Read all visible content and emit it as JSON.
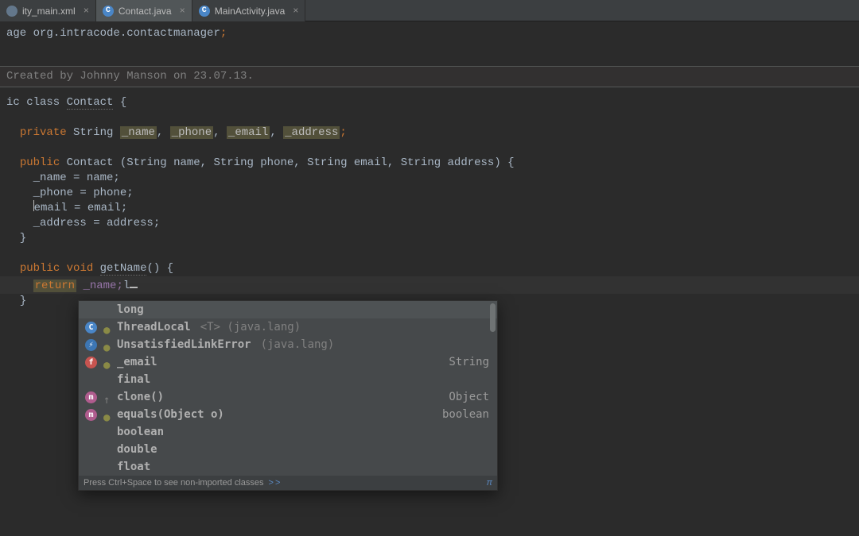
{
  "tabs": [
    {
      "label": "ity_main.xml",
      "icon_letter": "",
      "icon_class": "xml-icon",
      "active": false
    },
    {
      "label": "Contact.java",
      "icon_letter": "C",
      "icon_class": "java-icon",
      "active": true
    },
    {
      "label": "MainActivity.java",
      "icon_letter": "C",
      "icon_class": "java-icon",
      "active": false
    }
  ],
  "code": {
    "package_line_prefix": "age ",
    "package": "org.intracode.contactmanager",
    "comment_line": "Created by Johnny Manson on 23.07.13.",
    "class_decl_prefix": "ic class ",
    "class_name": "Contact",
    "class_decl_suffix": " {",
    "private_kw": "private",
    "string_type": "String",
    "fields": [
      "_name",
      "_phone",
      "_email",
      "_address"
    ],
    "public_kw": "public",
    "ctor": "Contact (String name, String phone, String email, String address) {",
    "assign": {
      "name": "_name = name;",
      "phone": "_phone = phone;",
      "email": "email = email;",
      "caret_line_prefix": "    ",
      "address": "_address = address;"
    },
    "void_kw": "void",
    "getname": "getName",
    "getname_suffix": "() {",
    "return_kw": "return",
    "return_val": "_name;",
    "typed": "l"
  },
  "popup": {
    "items": [
      {
        "icon": "",
        "icon_class": "",
        "label": "long",
        "aux": "",
        "type": "",
        "selected": true
      },
      {
        "icon": "C",
        "icon_class": "ic-class",
        "mod": "●",
        "label": "ThreadLocal",
        "aux": "<T> (java.lang)",
        "type": ""
      },
      {
        "icon": "●",
        "icon_class": "ic-except",
        "mod": "●",
        "label": "UnsatisfiedLinkError",
        "aux": "(java.lang)",
        "type": ""
      },
      {
        "icon": "f",
        "icon_class": "ic-field",
        "mod": "●",
        "label": "_email",
        "aux": "",
        "type": "String"
      },
      {
        "icon": "",
        "icon_class": "",
        "label": "final",
        "aux": "",
        "type": ""
      },
      {
        "icon": "m",
        "icon_class": "ic-method",
        "mod": "↑",
        "label": "clone()",
        "aux": "",
        "type": "Object"
      },
      {
        "icon": "m",
        "icon_class": "ic-method",
        "mod": "●",
        "label": "equals(Object o)",
        "aux": "",
        "type": "boolean"
      },
      {
        "icon": "",
        "icon_class": "",
        "label": "boolean",
        "aux": "",
        "type": ""
      },
      {
        "icon": "",
        "icon_class": "",
        "label": "double",
        "aux": "",
        "type": ""
      },
      {
        "icon": "",
        "icon_class": "",
        "label": "float",
        "aux": "",
        "type": ""
      }
    ],
    "footer_text": "Press Ctrl+Space to see non-imported classes",
    "footer_link": ">>",
    "footer_pi": "π"
  }
}
